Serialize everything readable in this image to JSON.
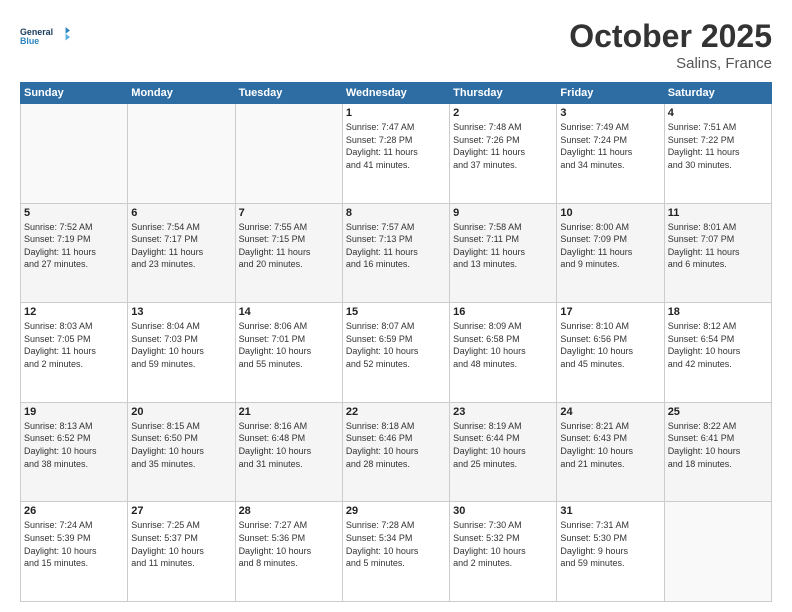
{
  "header": {
    "logo_line1": "General",
    "logo_line2": "Blue",
    "month": "October 2025",
    "location": "Salins, France"
  },
  "days_of_week": [
    "Sunday",
    "Monday",
    "Tuesday",
    "Wednesday",
    "Thursday",
    "Friday",
    "Saturday"
  ],
  "weeks": [
    [
      {
        "day": "",
        "info": ""
      },
      {
        "day": "",
        "info": ""
      },
      {
        "day": "",
        "info": ""
      },
      {
        "day": "1",
        "info": "Sunrise: 7:47 AM\nSunset: 7:28 PM\nDaylight: 11 hours\nand 41 minutes."
      },
      {
        "day": "2",
        "info": "Sunrise: 7:48 AM\nSunset: 7:26 PM\nDaylight: 11 hours\nand 37 minutes."
      },
      {
        "day": "3",
        "info": "Sunrise: 7:49 AM\nSunset: 7:24 PM\nDaylight: 11 hours\nand 34 minutes."
      },
      {
        "day": "4",
        "info": "Sunrise: 7:51 AM\nSunset: 7:22 PM\nDaylight: 11 hours\nand 30 minutes."
      }
    ],
    [
      {
        "day": "5",
        "info": "Sunrise: 7:52 AM\nSunset: 7:19 PM\nDaylight: 11 hours\nand 27 minutes."
      },
      {
        "day": "6",
        "info": "Sunrise: 7:54 AM\nSunset: 7:17 PM\nDaylight: 11 hours\nand 23 minutes."
      },
      {
        "day": "7",
        "info": "Sunrise: 7:55 AM\nSunset: 7:15 PM\nDaylight: 11 hours\nand 20 minutes."
      },
      {
        "day": "8",
        "info": "Sunrise: 7:57 AM\nSunset: 7:13 PM\nDaylight: 11 hours\nand 16 minutes."
      },
      {
        "day": "9",
        "info": "Sunrise: 7:58 AM\nSunset: 7:11 PM\nDaylight: 11 hours\nand 13 minutes."
      },
      {
        "day": "10",
        "info": "Sunrise: 8:00 AM\nSunset: 7:09 PM\nDaylight: 11 hours\nand 9 minutes."
      },
      {
        "day": "11",
        "info": "Sunrise: 8:01 AM\nSunset: 7:07 PM\nDaylight: 11 hours\nand 6 minutes."
      }
    ],
    [
      {
        "day": "12",
        "info": "Sunrise: 8:03 AM\nSunset: 7:05 PM\nDaylight: 11 hours\nand 2 minutes."
      },
      {
        "day": "13",
        "info": "Sunrise: 8:04 AM\nSunset: 7:03 PM\nDaylight: 10 hours\nand 59 minutes."
      },
      {
        "day": "14",
        "info": "Sunrise: 8:06 AM\nSunset: 7:01 PM\nDaylight: 10 hours\nand 55 minutes."
      },
      {
        "day": "15",
        "info": "Sunrise: 8:07 AM\nSunset: 6:59 PM\nDaylight: 10 hours\nand 52 minutes."
      },
      {
        "day": "16",
        "info": "Sunrise: 8:09 AM\nSunset: 6:58 PM\nDaylight: 10 hours\nand 48 minutes."
      },
      {
        "day": "17",
        "info": "Sunrise: 8:10 AM\nSunset: 6:56 PM\nDaylight: 10 hours\nand 45 minutes."
      },
      {
        "day": "18",
        "info": "Sunrise: 8:12 AM\nSunset: 6:54 PM\nDaylight: 10 hours\nand 42 minutes."
      }
    ],
    [
      {
        "day": "19",
        "info": "Sunrise: 8:13 AM\nSunset: 6:52 PM\nDaylight: 10 hours\nand 38 minutes."
      },
      {
        "day": "20",
        "info": "Sunrise: 8:15 AM\nSunset: 6:50 PM\nDaylight: 10 hours\nand 35 minutes."
      },
      {
        "day": "21",
        "info": "Sunrise: 8:16 AM\nSunset: 6:48 PM\nDaylight: 10 hours\nand 31 minutes."
      },
      {
        "day": "22",
        "info": "Sunrise: 8:18 AM\nSunset: 6:46 PM\nDaylight: 10 hours\nand 28 minutes."
      },
      {
        "day": "23",
        "info": "Sunrise: 8:19 AM\nSunset: 6:44 PM\nDaylight: 10 hours\nand 25 minutes."
      },
      {
        "day": "24",
        "info": "Sunrise: 8:21 AM\nSunset: 6:43 PM\nDaylight: 10 hours\nand 21 minutes."
      },
      {
        "day": "25",
        "info": "Sunrise: 8:22 AM\nSunset: 6:41 PM\nDaylight: 10 hours\nand 18 minutes."
      }
    ],
    [
      {
        "day": "26",
        "info": "Sunrise: 7:24 AM\nSunset: 5:39 PM\nDaylight: 10 hours\nand 15 minutes."
      },
      {
        "day": "27",
        "info": "Sunrise: 7:25 AM\nSunset: 5:37 PM\nDaylight: 10 hours\nand 11 minutes."
      },
      {
        "day": "28",
        "info": "Sunrise: 7:27 AM\nSunset: 5:36 PM\nDaylight: 10 hours\nand 8 minutes."
      },
      {
        "day": "29",
        "info": "Sunrise: 7:28 AM\nSunset: 5:34 PM\nDaylight: 10 hours\nand 5 minutes."
      },
      {
        "day": "30",
        "info": "Sunrise: 7:30 AM\nSunset: 5:32 PM\nDaylight: 10 hours\nand 2 minutes."
      },
      {
        "day": "31",
        "info": "Sunrise: 7:31 AM\nSunset: 5:30 PM\nDaylight: 9 hours\nand 59 minutes."
      },
      {
        "day": "",
        "info": ""
      }
    ]
  ]
}
